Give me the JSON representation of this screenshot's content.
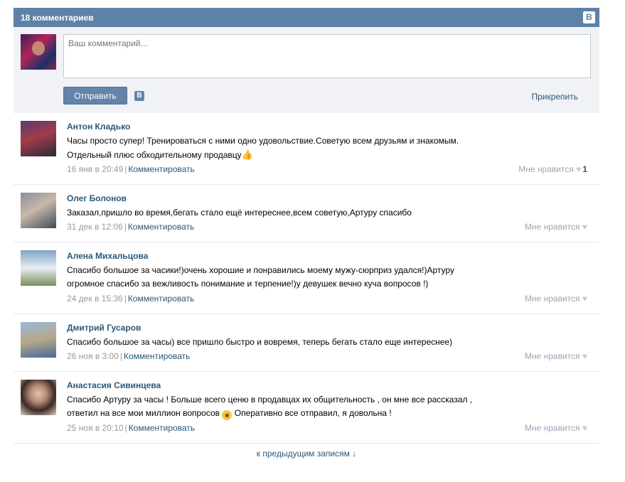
{
  "header": {
    "title": "18 комментариев",
    "vk_badge": "B"
  },
  "compose": {
    "placeholder": "Ваш комментарий...",
    "send_label": "Отправить",
    "vk_small": "B",
    "attach_label": "Прикрепить"
  },
  "comments": [
    {
      "name": "Антон Кладько",
      "text": "Часы просто супер! Тренироваться с ними одно удовольствие.Советую всем друзьям и знакомым.",
      "text2": "Отдельный плюс обходительному продавцу",
      "date": "16 янв в 20:49",
      "reply": "Комментировать",
      "like": "Мне нравится",
      "like_count": "1"
    },
    {
      "name": "Олег Болонов",
      "text": "Заказал,пришло во время,бегать стало ещё интереснее,всем советую,Артуру спасибо",
      "date": "31 дек в 12:06",
      "reply": "Комментировать",
      "like": "Мне нравится"
    },
    {
      "name": "Алена Михальцова",
      "text": "Спасибо большое за часики!)очень хорошие и понравились моему мужу-сюрприз удался!)Артуру",
      "text2": "огромное спасибо за вежливость понимание и терпение!)у девушек вечно куча вопросов !)",
      "date": "24 дек в 15:36",
      "reply": "Комментировать",
      "like": "Мне нравится"
    },
    {
      "name": "Дмитрий Гусаров",
      "text": "Спасибо большое за часы) все пришло быстро и вовремя, теперь бегать стало еще интереснее)",
      "date": "26 ноя в 3:00",
      "reply": "Комментировать",
      "like": "Мне нравится"
    },
    {
      "name": "Анастасия Сивинцева",
      "text": "Спасибо Артуру за часы ! Больше всего ценю в продавцах их общительность , он мне все рассказал ,",
      "text2a": "ответил на все мои миллион вопросов",
      "text2b": "Оперативно все отправил, я довольна !",
      "date": "25 ноя в 20:10",
      "reply": "Комментировать",
      "like": "Мне нравится"
    }
  ],
  "footer": {
    "more_label": "к предыдущим записям ↓"
  },
  "colors": {
    "header_bg": "#5e81a8",
    "link": "#2b587a",
    "compose_bg": "#f0f2f5"
  }
}
